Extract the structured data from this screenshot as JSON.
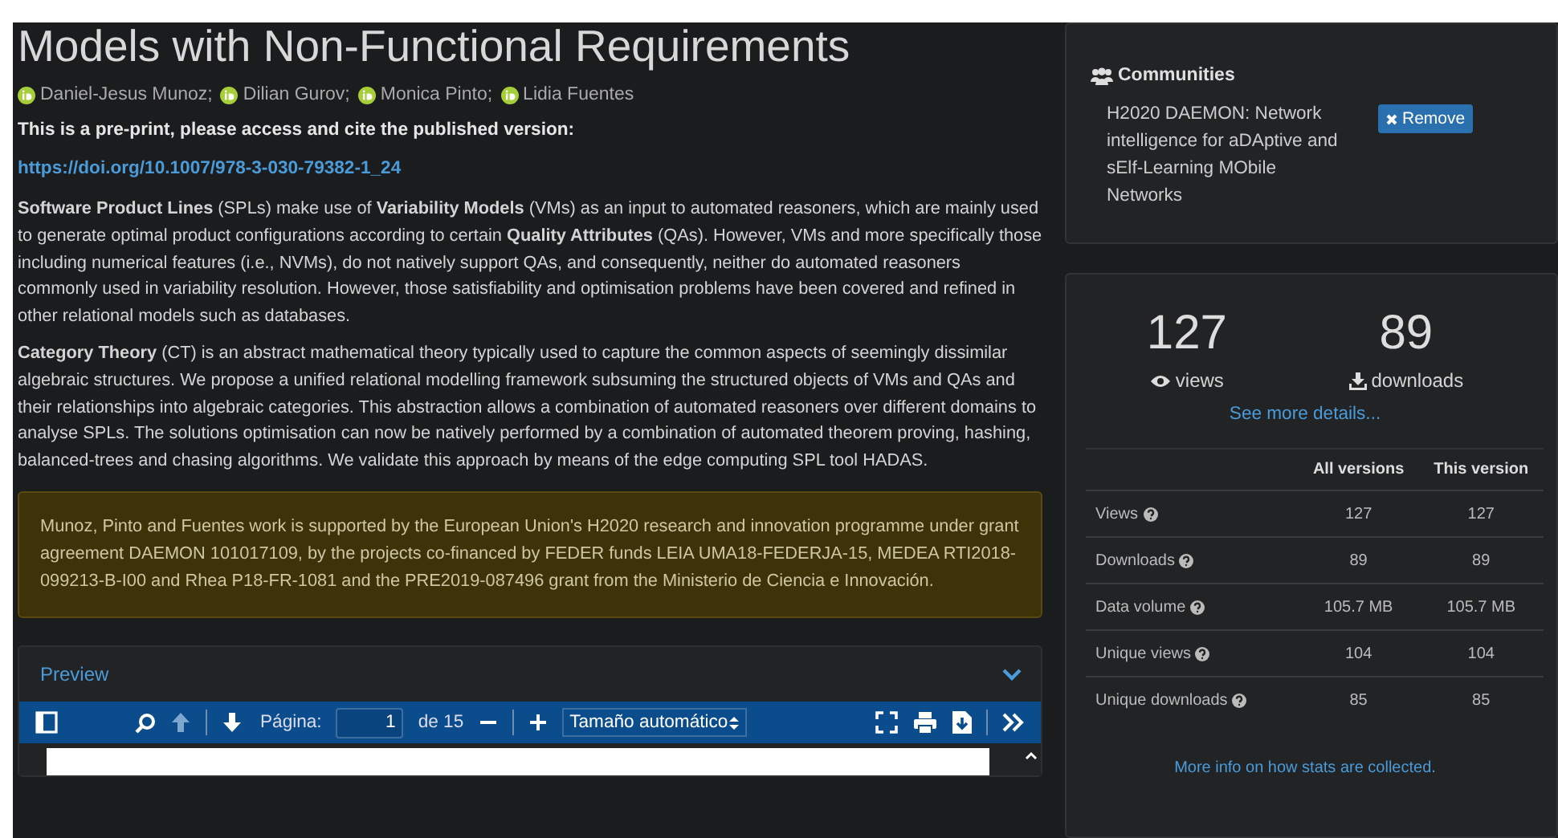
{
  "title": "Models with Non-Functional Requirements",
  "authors": [
    "Daniel-Jesus Munoz;",
    "Dilian Gurov;",
    "Monica Pinto;",
    "Lidia Fuentes"
  ],
  "notice": "This is a pre-print, please access and cite the published version:",
  "doi_link": "https://doi.org/10.1007/978-3-030-79382-1_24",
  "abstract": [
    "**Software Product Lines** (SPLs) make use of **Variability Models** (VMs) as an input to automated reasoners, which are mainly used to generate optimal product configurations according to certain **Quality Attributes** (QAs). However, VMs and more specifically those including numerical features (i.e., NVMs), do not natively support QAs, and consequently, neither do automated reasoners commonly used in variability resolution. However, those satisfiability and optimisation problems have been covered and refined in other relational models such as databases.",
    "**Category Theory** (CT) is an abstract mathematical theory typically used to capture the common aspects of seemingly dissimilar algebraic structures. We propose a unified relational modelling framework subsuming the structured objects of VMs and QAs and their relationships into algebraic categories. This abstraction allows a combination of automated reasoners over different domains to analyse SPLs. The solutions optimisation can now be natively performed by a combination of automated theorem proving, hashing, balanced-trees and chasing algorithms. We validate this approach by means of the edge computing SPL tool HADAS."
  ],
  "funding": "Munoz, Pinto and Fuentes work is supported by the European Union's H2020 research and innovation programme under grant agreement DAEMON 101017109, by the projects co-financed by FEDER funds LEIA UMA18-FEDERJA-15, MEDEA RTI2018-099213-B-I00 and Rhea P18-FR-1081 and the PRE2019-087496 grant from the Ministerio de Ciencia e Innovación.",
  "preview": {
    "title": "Preview",
    "expanded": true,
    "toolbar": {
      "page_label": "Página:",
      "page_value": "1",
      "page_total": "de 15",
      "zoom_value": "Tamaño automático"
    }
  },
  "communities": {
    "title": "Communities",
    "items": [
      {
        "name": "H2020 DAEMON: Network intelligence for aDAptive and sElf-Learning MObile Networks",
        "action": "Remove"
      }
    ]
  },
  "stats": {
    "views": "127",
    "views_label": "views",
    "downloads": "89",
    "downloads_label": "downloads",
    "details_link": "See more details...",
    "columns": [
      "All versions",
      "This version"
    ],
    "rows": [
      {
        "label": "Views",
        "all": "127",
        "this": "127"
      },
      {
        "label": "Downloads",
        "all": "89",
        "this": "89"
      },
      {
        "label": "Data volume",
        "all": "105.7 MB",
        "this": "105.7 MB"
      },
      {
        "label": "Unique views",
        "all": "104",
        "this": "104"
      },
      {
        "label": "Unique downloads",
        "all": "85",
        "this": "85"
      }
    ],
    "info_link": "More info on how stats are collected."
  }
}
